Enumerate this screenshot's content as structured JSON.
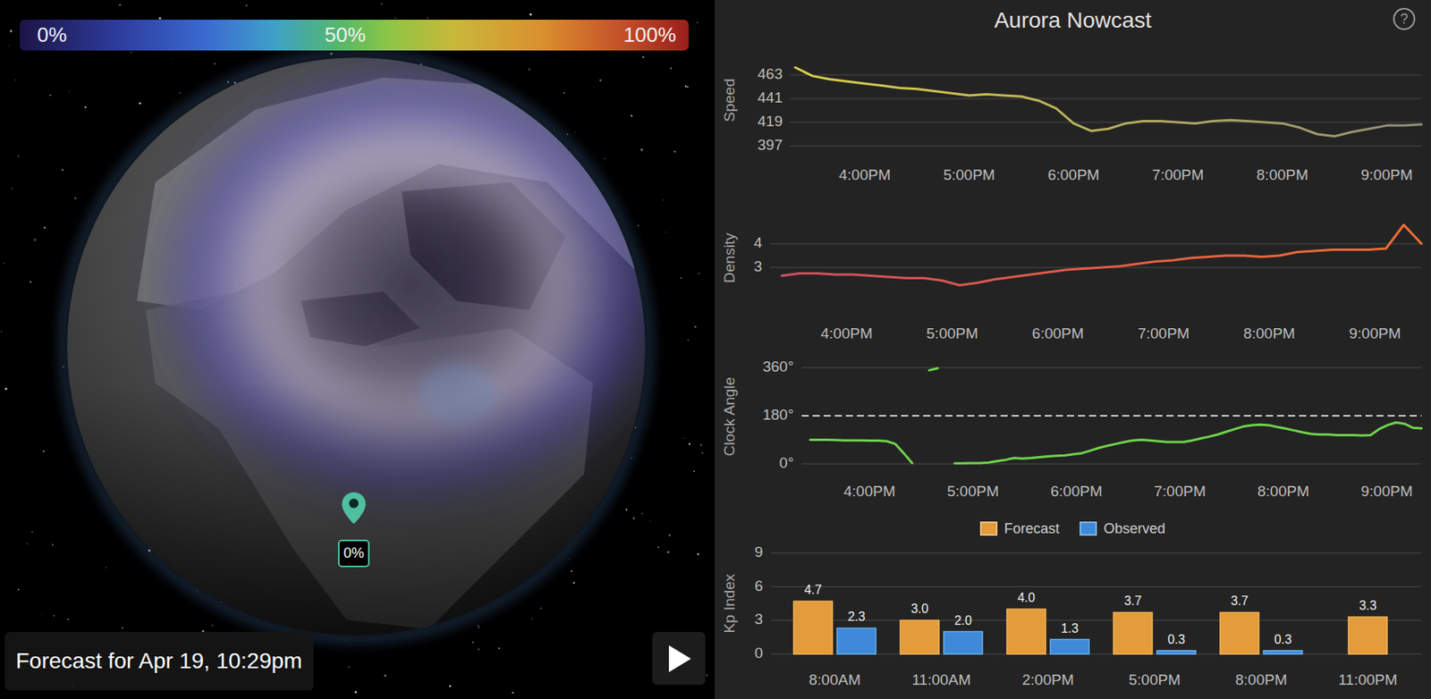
{
  "colorbar": {
    "labels": [
      "0%",
      "50%",
      "100%"
    ]
  },
  "map": {
    "pin": {
      "label": "0%"
    },
    "forecast_label": "Forecast for Apr 19, 10:29pm"
  },
  "panel": {
    "title": "Aurora Nowcast",
    "help": "?"
  },
  "charts": {
    "speed": {
      "title": "Speed",
      "ticks": [
        "463",
        "441",
        "419",
        "397"
      ],
      "x_labels": [
        "4:00PM",
        "5:00PM",
        "6:00PM",
        "7:00PM",
        "8:00PM",
        "9:00PM"
      ],
      "values": [
        470,
        462,
        459,
        457,
        455,
        453,
        451,
        450,
        448,
        446,
        444,
        445,
        444,
        443,
        439,
        432,
        418,
        411,
        413,
        418,
        420,
        420,
        419,
        418,
        420,
        421,
        420,
        419,
        418,
        414,
        408,
        406,
        410,
        413,
        416,
        416,
        417
      ]
    },
    "density": {
      "title": "Density",
      "ticks": [
        "4",
        "3"
      ],
      "x_labels": [
        "4:00PM",
        "5:00PM",
        "6:00PM",
        "7:00PM",
        "8:00PM",
        "9:00PM"
      ],
      "values": [
        2.65,
        2.75,
        2.75,
        2.7,
        2.7,
        2.65,
        2.6,
        2.55,
        2.55,
        2.45,
        2.25,
        2.35,
        2.5,
        2.6,
        2.7,
        2.8,
        2.9,
        2.95,
        3.0,
        3.05,
        3.15,
        3.25,
        3.3,
        3.4,
        3.45,
        3.5,
        3.5,
        3.45,
        3.5,
        3.65,
        3.7,
        3.75,
        3.75,
        3.75,
        3.8,
        4.8,
        4.0
      ]
    },
    "clock_angle": {
      "title": "Clock Angle",
      "ticks": [
        "360°",
        "180°",
        "0°"
      ],
      "x_labels": [
        "4:00PM",
        "5:00PM",
        "6:00PM",
        "7:00PM",
        "8:00PM",
        "9:00PM"
      ],
      "values": [
        90,
        90,
        90,
        89,
        88,
        88,
        88,
        87,
        87,
        85,
        75,
        40,
        3,
        null,
        350,
        358,
        null,
        2,
        2,
        3,
        3,
        5,
        10,
        15,
        22,
        20,
        22,
        25,
        28,
        30,
        32,
        36,
        40,
        50,
        60,
        68,
        75,
        82,
        88,
        90,
        88,
        85,
        82,
        82,
        82,
        88,
        95,
        102,
        110,
        120,
        130,
        140,
        145,
        147,
        145,
        138,
        132,
        125,
        118,
        112,
        110,
        110,
        108,
        108,
        108,
        106,
        108,
        130,
        145,
        155,
        150,
        135,
        133
      ]
    }
  },
  "kp": {
    "title": "Kp Index",
    "ticks": [
      "9",
      "6",
      "3",
      "0"
    ],
    "x_labels": [
      "8:00AM",
      "11:00AM",
      "2:00PM",
      "5:00PM",
      "8:00PM",
      "11:00PM"
    ],
    "series": [
      {
        "name": "Forecast",
        "color": "#e39b3b",
        "values": [
          4.7,
          3.0,
          4.0,
          3.7,
          3.7,
          3.3
        ],
        "labels": [
          "4.7",
          "3.0",
          "4.0",
          "3.7",
          "3.7",
          "3.3"
        ]
      },
      {
        "name": "Observed",
        "color": "#3e8ad8",
        "values": [
          2.3,
          2.0,
          1.3,
          0.3,
          0.3
        ],
        "labels": [
          "2.3",
          "2.0",
          "1.3",
          "0.3",
          "0.3"
        ]
      }
    ]
  }
}
